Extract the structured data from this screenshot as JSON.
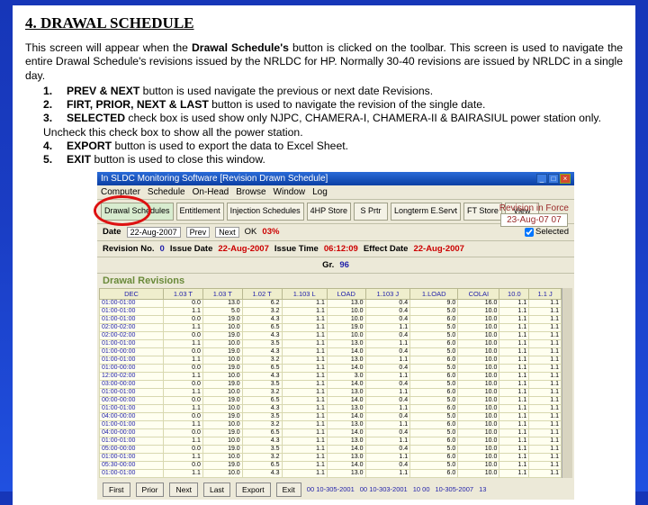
{
  "doc": {
    "heading": "4. DRAWAL SCHEDULE",
    "intro_pre": "This screen will appear when the ",
    "intro_bold": "Drawal Schedule's",
    "intro_post": " button is clicked on the toolbar. This screen is used to navigate the entire Drawal Schedule's revisions issued by the NRLDC for HP. Normally 30-40 revisions are issued by NRLDC in a single day.",
    "points": [
      {
        "n": "1.",
        "b": "PREV & NEXT",
        "t": " button is used navigate the previous or next date Revisions."
      },
      {
        "n": "2.",
        "b": "FIRT, PRIOR, NEXT & LAST",
        "t": " button is used to navigate the revision of the single date."
      },
      {
        "n": "3.",
        "b": "SELECTED",
        "t": " check box is used show only NJPC, CHAMERA-I, CHAMERA-II & BAIRASIUL power station only. Uncheck this check box to show all the power station.",
        "cont": true
      },
      {
        "n": "4.",
        "b": "EXPORT",
        "t": " button is used to export the data to Excel Sheet."
      },
      {
        "n": "5.",
        "b": "EXIT",
        "t": " button is used to close this window."
      }
    ]
  },
  "app": {
    "title": "In SLDC Monitoring Software  [Revision Drawn Schedule]",
    "menus": [
      "Computer",
      "Schedule",
      "On-Head",
      "Browse",
      "Window",
      "Log"
    ],
    "toolbar": [
      "Drawal Schedules",
      "Entitlement",
      "Injection Schedules",
      "4HP Store",
      "S Prtr",
      "Longterm E.Servt",
      "FT Store",
      "View"
    ],
    "revforce_label": "Revision in Force",
    "revforce_date": "23-Aug-07  07",
    "controls": {
      "date_label": "Date",
      "date_value": "22-Aug-2007",
      "prev": "Prev",
      "next": "Next",
      "ok_label": "OK",
      "ok_value": "03%",
      "selected_label": "Selected"
    },
    "line2": {
      "rev_label": "Revision No.",
      "rev_value": "0",
      "issue_date_label": "Issue Date",
      "issue_date": "22-Aug-2007",
      "issue_time_label": "Issue Time",
      "issue_time": "06:12:09",
      "eff_label": "Effect Date",
      "eff_date": "22-Aug-2007"
    },
    "line3": {
      "gr": "Gr. ",
      "grval": "96"
    },
    "section": "Drawal Revisions",
    "headers": [
      "DEC",
      "1.03 T",
      "1.03 T",
      "1.02 T",
      "1.103 L",
      "LOAD",
      "1.103 J",
      "1.LOAD",
      "COLAI",
      "10.0",
      "1.1 J"
    ],
    "rows": [
      [
        "01:00-01:00",
        "0.0",
        "13.0",
        "6.2",
        "1.1",
        "13.0",
        "0.4",
        "9.0",
        "16.0",
        "1.1",
        "1.1"
      ],
      [
        "01:00-01:00",
        "1.1",
        "5.0",
        "3.2",
        "1.1",
        "10.0",
        "0.4",
        "5.0",
        "10.0",
        "1.1",
        "1.1"
      ],
      [
        "01:00-01:00",
        "0.0",
        "19.0",
        "4.3",
        "1.1",
        "10.0",
        "0.4",
        "6.0",
        "10.0",
        "1.1",
        "1.1"
      ],
      [
        "02:00-02:00",
        "1.1",
        "10.0",
        "6.5",
        "1.1",
        "19.0",
        "1.1",
        "5.0",
        "10.0",
        "1.1",
        "1.1"
      ],
      [
        "02:00-02:00",
        "0.0",
        "19.0",
        "4.3",
        "1.1",
        "10.0",
        "0.4",
        "5.0",
        "10.0",
        "1.1",
        "1.1"
      ],
      [
        "01:00-01:00",
        "1.1",
        "10.0",
        "3.5",
        "1.1",
        "13.0",
        "1.1",
        "6.0",
        "10.0",
        "1.1",
        "1.1"
      ],
      [
        "01:00-00:00",
        "0.0",
        "19.0",
        "4.3",
        "1.1",
        "14.0",
        "0.4",
        "5.0",
        "10.0",
        "1.1",
        "1.1"
      ],
      [
        "01:00-01:00",
        "1.1",
        "10.0",
        "3.2",
        "1.1",
        "13.0",
        "1.1",
        "6.0",
        "10.0",
        "1.1",
        "1.1"
      ],
      [
        "01:00-00:00",
        "0.0",
        "19.0",
        "6.5",
        "1.1",
        "14.0",
        "0.4",
        "5.0",
        "10.0",
        "1.1",
        "1.1"
      ],
      [
        "12:00-02:00",
        "1.1",
        "10.0",
        "4.3",
        "1.1",
        "3.0",
        "1.1",
        "6.0",
        "10.0",
        "1.1",
        "1.1"
      ],
      [
        "03:00-00:00",
        "0.0",
        "19.0",
        "3.5",
        "1.1",
        "14.0",
        "0.4",
        "5.0",
        "10.0",
        "1.1",
        "1.1"
      ],
      [
        "01:00-01:00",
        "1.1",
        "10.0",
        "3.2",
        "1.1",
        "13.0",
        "1.1",
        "6.0",
        "10.0",
        "1.1",
        "1.1"
      ],
      [
        "00:00-00:00",
        "0.0",
        "19.0",
        "6.5",
        "1.1",
        "14.0",
        "0.4",
        "5.0",
        "10.0",
        "1.1",
        "1.1"
      ],
      [
        "01:00-01:00",
        "1.1",
        "10.0",
        "4.3",
        "1.1",
        "13.0",
        "1.1",
        "6.0",
        "10.0",
        "1.1",
        "1.1"
      ],
      [
        "04:00-00:00",
        "0.0",
        "19.0",
        "3.5",
        "1.1",
        "14.0",
        "0.4",
        "5.0",
        "10.0",
        "1.1",
        "1.1"
      ],
      [
        "01:00-01:00",
        "1.1",
        "10.0",
        "3.2",
        "1.1",
        "13.0",
        "1.1",
        "6.0",
        "10.0",
        "1.1",
        "1.1"
      ],
      [
        "04:00-00:00",
        "0.0",
        "19.0",
        "6.5",
        "1.1",
        "14.0",
        "0.4",
        "5.0",
        "10.0",
        "1.1",
        "1.1"
      ],
      [
        "01:00-01:00",
        "1.1",
        "10.0",
        "4.3",
        "1.1",
        "13.0",
        "1.1",
        "6.0",
        "10.0",
        "1.1",
        "1.1"
      ],
      [
        "05:00-00:00",
        "0.0",
        "19.0",
        "3.5",
        "1.1",
        "14.0",
        "0.4",
        "5.0",
        "10.0",
        "1.1",
        "1.1"
      ],
      [
        "01:00-01:00",
        "1.1",
        "10.0",
        "3.2",
        "1.1",
        "13.0",
        "1.1",
        "6.0",
        "10.0",
        "1.1",
        "1.1"
      ],
      [
        "05:30-00:00",
        "0.0",
        "19.0",
        "6.5",
        "1.1",
        "14.0",
        "0.4",
        "5.0",
        "10.0",
        "1.1",
        "1.1"
      ],
      [
        "01:00-01:00",
        "1.1",
        "10.0",
        "4.3",
        "1.1",
        "13.0",
        "1.1",
        "6.0",
        "10.0",
        "1.1",
        "1.1"
      ]
    ],
    "footer": {
      "buttons": [
        "First",
        "Prior",
        "Next",
        "Last",
        "Export",
        "Exit"
      ],
      "stats": [
        "00 10-305-2001",
        "00 10-303-2001",
        "10 00",
        "10-305-2007",
        "13"
      ]
    }
  }
}
